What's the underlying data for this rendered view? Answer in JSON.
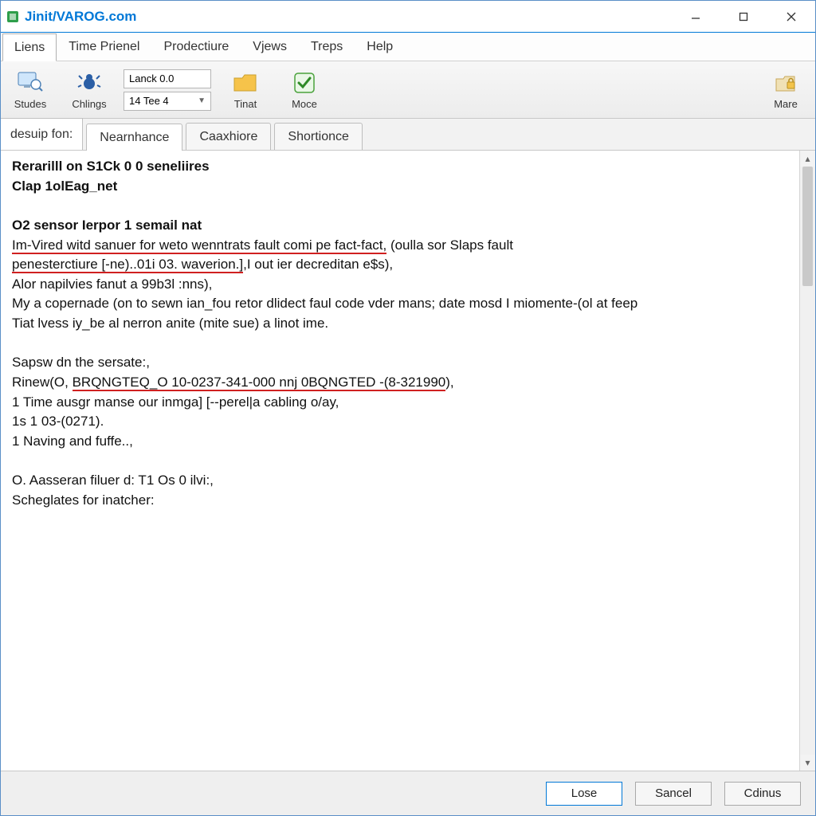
{
  "window": {
    "title": "Jinit/VAROG.com"
  },
  "menus": {
    "items": [
      "Liens",
      "Time Prienel",
      "Prodectiure",
      "Vjews",
      "Treps",
      "Help"
    ],
    "selected_index": 0
  },
  "toolbar": {
    "studes": "Studes",
    "chings": "Chlings",
    "combo1": "Lanck 0.0",
    "combo2": "14 Tee 4",
    "tinat": "Tinat",
    "moce": "Moce",
    "mare": "Mare"
  },
  "tabs": {
    "side_label": "desuip fon:",
    "items": [
      "Nearnhance",
      "Caaxhiore",
      "Shortionce"
    ],
    "active_index": 0
  },
  "body": {
    "l1a": "Rerarilll on S1Ck 0 0 seneliires",
    "l1b": "Clap 1olEag_net",
    "l2": "O2 sensor Ierpor 1 semail nat",
    "l3_u1": "Im-Vired witd sanuer for weto wenntrats fault comi pe fact-fact,",
    "l3_end": " (oulla sor Slaps fault",
    "l4_u": "penesterctiure [-ne)..01i 03. waverion.]",
    "l4_end": ",I out ier decreditan e$s),",
    "l5": "Alor napilvies fanut a 99b3l :nns),",
    "l6": "My a copernade (on to sewn ian_fou retor dlidect faul code vder mans; date mosd I miomente-(ol at feep",
    "l7": "Tiat lvess iy_be al nerron anite (mite sue) a linot ime.",
    "l8": "Sapsw dn the sersate:,",
    "l9_pre": "Rinew(O, ",
    "l9_u": "BRQNGTEQ_O 10-0237-341-000 nnj 0BQNGTED -(8-321990",
    "l9_end": "),",
    "l10": "1 Time ausgr manse our inmga] [--perel|a cabling o/ay,",
    "l10b": "1s 1 03-(0271).",
    "l11": "1 Naving and fuffe..,",
    "l12": "O. Aasseran filuer d: T1 Os 0 ilvi:,",
    "l13": "Scheglates for inatcher:"
  },
  "footer": {
    "primary": "Lose",
    "cancel": "Sancel",
    "third": "Cdinus"
  }
}
